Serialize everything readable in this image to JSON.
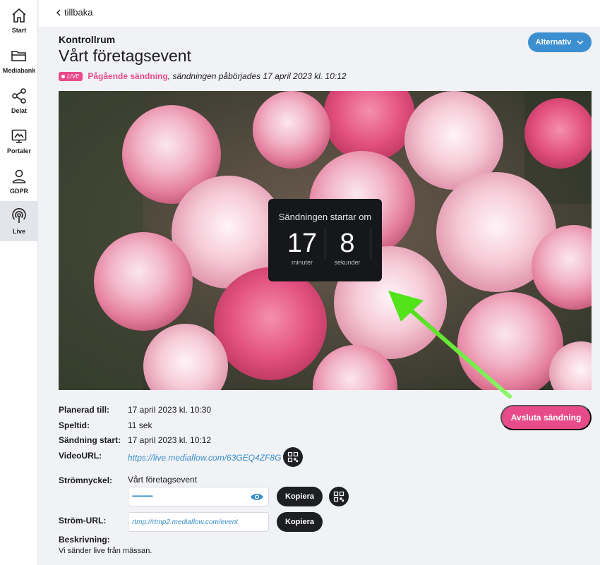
{
  "sidebar": {
    "items": [
      {
        "label": "Start",
        "icon": "home-icon"
      },
      {
        "label": "Mediabank",
        "icon": "folder-icon"
      },
      {
        "label": "Delat",
        "icon": "share-icon"
      },
      {
        "label": "Portaler",
        "icon": "portal-icon"
      },
      {
        "label": "GDPR",
        "icon": "user-icon"
      },
      {
        "label": "Live",
        "icon": "broadcast-icon",
        "active": true
      }
    ]
  },
  "topbar": {
    "back_label": "tillbaka"
  },
  "header": {
    "section": "Kontrollrum",
    "title": "Vårt företagsevent",
    "live_badge": "LIVE",
    "status_strong": "Pågående sändning",
    "status_rest": ", sändningen påbörjades 17 april 2023 kl. 10:12",
    "options_label": "Alternativ"
  },
  "countdown": {
    "title": "Sändningen startar om",
    "minutes": "17",
    "minutes_label": "minuter",
    "seconds": "8",
    "seconds_label": "sekunder"
  },
  "details": {
    "planned_label": "Planerad till:",
    "planned_value": "17 april 2023 kl. 10:30",
    "playtime_label": "Speltid:",
    "playtime_value": "11 sek",
    "start_label": "Sändning start:",
    "start_value": "17 april 2023 kl. 10:12",
    "videourl_label": "VideoURL:",
    "videourl_value": "https://live.mediaflow.com/63GEQ4ZF8G",
    "streamkey_label": "Strömnyckel:",
    "streamkey_name": "Vårt företagsevent",
    "streamkey_masked": "••••••••••••••••",
    "copy_label": "Kopiera",
    "streamurl_label": "Ström-URL:",
    "streamurl_value": "rtmp://rtmp2.mediaflow.com/event",
    "copy2_label": "Kopiera",
    "description_label": "Beskrivning:",
    "description_value": "Vi sänder live från mässan."
  },
  "actions": {
    "end_label": "Avsluta sändning"
  },
  "colors": {
    "accent": "#e84b8a",
    "primary": "#3c8fd0",
    "dark": "#1e1f23"
  }
}
